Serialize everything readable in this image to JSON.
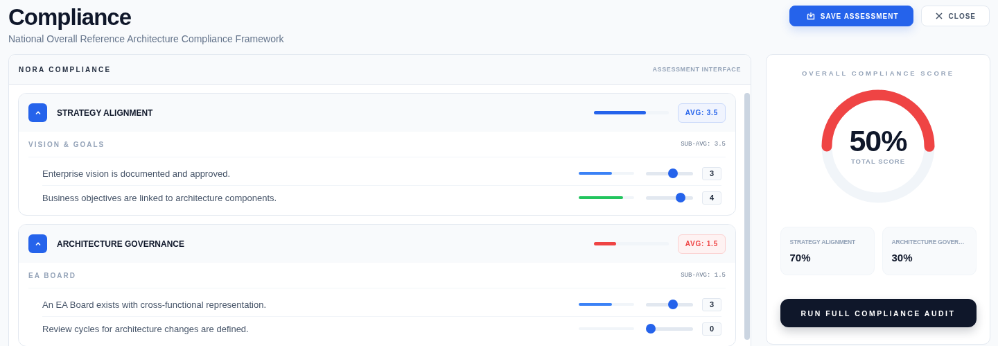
{
  "header": {
    "title": "Compliance",
    "subtitle": "National Overall Reference Architecture Compliance Framework",
    "buttons": [
      {
        "kind": "primary",
        "label": "SAVE ASSESSMENT"
      },
      {
        "kind": "secondary",
        "label": "CLOSE"
      }
    ]
  },
  "panel": {
    "title": "NORA COMPLIANCE",
    "caption": "ASSESSMENT INTERFACE",
    "sections": [
      {
        "title": "STRATEGY ALIGNMENT",
        "expanded": true,
        "level": 0.7,
        "color": "#2563eb",
        "badge": "AVG: 3.5",
        "groups": [
          {
            "title": "VISION & GOALS",
            "sub_avg": "SUB-AVG: 3.5",
            "items": [
              {
                "text": "Enterprise vision is documented and approved.",
                "level": 0.6,
                "color": "#3b82f6",
                "value": "3"
              },
              {
                "text": "Business objectives are linked to architecture components.",
                "level": 0.8,
                "color": "#22c55e",
                "value": "4"
              }
            ]
          }
        ]
      },
      {
        "title": "ARCHITECTURE GOVERNANCE",
        "expanded": true,
        "level": 0.3,
        "color": "#ef4444",
        "badge": "AVG: 1.5",
        "groups": [
          {
            "title": "EA BOARD",
            "sub_avg": "SUB-AVG: 1.5",
            "items": [
              {
                "text": "An EA Board exists with cross-functional representation.",
                "level": 0.6,
                "color": "#3b82f6",
                "value": "3"
              },
              {
                "text": "Review cycles for architecture changes are defined.",
                "level": 0,
                "value": "0"
              }
            ]
          }
        ]
      }
    ]
  },
  "score": {
    "title": "OVERALL COMPLIANCE SCORE",
    "level": 0.5,
    "color": "#ef4444",
    "value": "50%",
    "caption": "TOTAL SCORE",
    "stats": [
      {
        "label": "STRATEGY ALIGNMENT",
        "value": "70%"
      },
      {
        "label": "ARCHITECTURE GOVER…",
        "value": "30%"
      }
    ],
    "button": "RUN FULL COMPLIANCE AUDIT"
  }
}
